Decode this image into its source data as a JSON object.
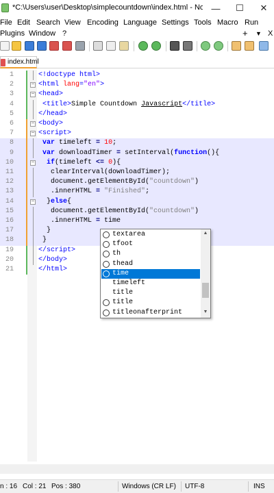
{
  "window": {
    "title": "*C:\\Users\\user\\Desktop\\simplecountdown\\index.html - Not...",
    "minimize_icon": "minimize-icon",
    "maximize_icon": "maximize-icon",
    "close_icon": "close-icon"
  },
  "menu": {
    "row1": [
      "File",
      "Edit",
      "Search",
      "View",
      "Encoding",
      "Language",
      "Settings",
      "Tools",
      "Macro",
      "Run"
    ],
    "row2": [
      "Plugins",
      "Window",
      "?"
    ],
    "plus": "+",
    "dropdown": "▼",
    "close": "X"
  },
  "tab": {
    "label": "index.html",
    "color": "#e05050"
  },
  "editor": {
    "lines": [
      {
        "n": "1",
        "html": "<span class=\"t-tag\">&lt;!doctype html&gt;</span>"
      },
      {
        "n": "2",
        "html": "<span class=\"t-tag\">&lt;html </span><span class=\"t-attr\">lang</span><span class=\"t-tag\">=</span><span class=\"t-str\">\"en\"</span><span class=\"t-tag\">&gt;</span>"
      },
      {
        "n": "3",
        "html": "<span class=\"t-tag\">&lt;head&gt;</span>"
      },
      {
        "n": "4",
        "html": " <span class=\"t-tag\">&lt;title&gt;</span>Simple Countdown <u>Javascript</u><span class=\"t-tag\">&lt;/title&gt;</span>"
      },
      {
        "n": "5",
        "html": "<span class=\"t-tag\">&lt;/head&gt;</span>"
      },
      {
        "n": "6",
        "html": "<span class=\"t-tag\">&lt;body&gt;</span>"
      },
      {
        "n": "7",
        "html": "<span class=\"t-tag\">&lt;script&gt;</span>"
      },
      {
        "n": "8",
        "html": " <span class=\"t-kw\">var</span> timeleft <span class=\"t-op\">=</span> <span class=\"t-num\">10</span>;"
      },
      {
        "n": "9",
        "html": " <span class=\"t-kw\">var</span> downloadTimer <span class=\"t-op\">=</span> setInterval(<span class=\"t-kw\">function</span>(){"
      },
      {
        "n": "10",
        "html": "  <span class=\"t-kw\">if</span>(timeleft <span class=\"t-op\">&lt;=</span> <span class=\"t-num\">0</span>){"
      },
      {
        "n": "11",
        "html": "   clearInterval(downloadTimer);"
      },
      {
        "n": "12",
        "html": "   document.getElementById(<span class=\"t-strjs\">\"countdown\"</span>)"
      },
      {
        "n": "13",
        "html": "   .innerHTML <span class=\"t-op\">=</span> <span class=\"t-strjs\">\"Finished\"</span>;"
      },
      {
        "n": "14",
        "html": "  }<span class=\"t-kw\">else</span>{"
      },
      {
        "n": "15",
        "html": "   document.getElementById(<span class=\"t-strjs\">\"countdown\"</span>)"
      },
      {
        "n": "16",
        "html": "   .innerHTML <span class=\"t-op\">=</span> time"
      },
      {
        "n": "17",
        "html": "  }"
      },
      {
        "n": "18",
        "html": " }"
      },
      {
        "n": "19",
        "html": "<span class=\"t-tag\">&lt;/script&gt;</span>"
      },
      {
        "n": "20",
        "html": "<span class=\"t-tag\">&lt;/body&gt;</span>"
      },
      {
        "n": "21",
        "html": "<span class=\"t-tag\">&lt;/html&gt;</span>"
      }
    ]
  },
  "autocomplete": {
    "items": [
      "textarea",
      "tfoot",
      "th",
      "thead",
      "time",
      "timeleft",
      "title",
      "title",
      "titleonafterprint"
    ],
    "icons": [
      true,
      true,
      true,
      true,
      true,
      false,
      false,
      true,
      true
    ],
    "selected_index": 4,
    "selected_color": "#0078d7"
  },
  "status": {
    "ln": "n : 16",
    "col": "Col : 21",
    "pos": "Pos : 380",
    "eol": "Windows (CR LF)",
    "encoding": "UTF-8",
    "mode": "INS"
  }
}
